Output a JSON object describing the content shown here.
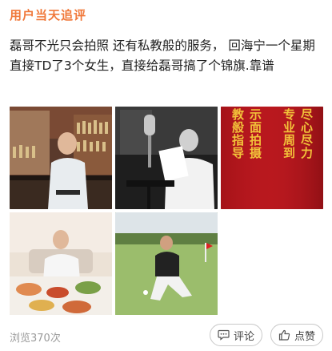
{
  "header": {
    "title": "用户当天追评"
  },
  "post": {
    "text": "磊哥不光只会拍照 还有私教般的服务， 回海宁一个星期直接TD了3个女生，直接给磊哥搞了个锦旗.靠谱"
  },
  "photos": [
    {
      "desc": "bar-photo"
    },
    {
      "desc": "studio-photo"
    },
    {
      "desc": "banner-photo",
      "banner_lines": [
        "教般指导",
        "示面拍摄",
        "专业周到",
        "尽心尽力"
      ]
    },
    {
      "desc": "dinner-photo"
    },
    {
      "desc": "golf-photo"
    }
  ],
  "footer": {
    "views": "浏览370次",
    "comment_label": "评论",
    "like_label": "点赞"
  },
  "colors": {
    "accent": "#f0783a",
    "muted": "#9a9a9a"
  },
  "icons": {
    "comment": "comment-icon",
    "like": "thumbs-up-icon"
  }
}
